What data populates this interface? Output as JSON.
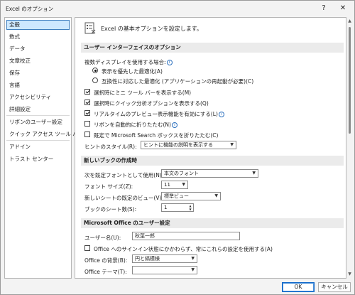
{
  "window": {
    "title": "Excel のオプション",
    "help_label": "?",
    "close_label": "✕"
  },
  "sidebar": {
    "items": [
      {
        "label": "全般"
      },
      {
        "label": "数式"
      },
      {
        "label": "データ"
      },
      {
        "label": "文章校正"
      },
      {
        "label": "保存"
      },
      {
        "label": "言語"
      },
      {
        "label": "アクセシビリティ"
      },
      {
        "label": "詳細設定"
      },
      {
        "label": "リボンのユーザー設定"
      },
      {
        "label": "クイック アクセス ツール バー"
      },
      {
        "label": "アドイン"
      },
      {
        "label": "トラスト センター"
      }
    ]
  },
  "main": {
    "header": "Excel の基本オプションを設定します。",
    "ui_section": {
      "title": "ユーザー インターフェイスのオプション",
      "multi_display_label": "複数ディスプレイを使用する場合:",
      "radio_appearance": "表示を優先した最適化(A)",
      "radio_compat": "互換性に対応した最適化 (アプリケーションの再起動が必要)(C)",
      "cb_minitoolbar": "選択時にミニ ツール バーを表示する(M)",
      "cb_quickanalysis": "選択時にクイック分析オプションを表示する(Q)",
      "cb_livepreview": "リアルタイムのプレビュー表示機能を有効にする(L)",
      "cb_ribbon_collapse": "リボンを自動的に折りたたむ(N)",
      "cb_search_collapse": "既定で Microsoft Search ボックスを折りたたむ(C)",
      "tooltip_label": "ヒントのスタイル(R):",
      "tooltip_value": "ヒントに機能の説明を表示する"
    },
    "new_wb_section": {
      "title": "新しいブックの作成時",
      "default_font_label": "次を既定フォントとして使用(N):",
      "default_font_value": "本文のフォント",
      "font_size_label": "フォント サイズ(Z):",
      "font_size_value": "11",
      "default_view_label": "新しいシートの既定のビュー(V):",
      "default_view_value": "標準ビュー",
      "sheet_count_label": "ブックのシート数(S):",
      "sheet_count_value": "1"
    },
    "office_section": {
      "title": "Microsoft Office のユーザー設定",
      "username_label": "ユーザー名(U):",
      "username_value": "秋葉一郎",
      "always_use_label": "Office へのサインイン状態にかかわらず、常にこれらの設定を使用する(A)",
      "background_label": "Office の背景(B):",
      "background_value": "円と縞模様",
      "theme_label": "Office テーマ(T):",
      "theme_value": ""
    }
  },
  "footer": {
    "ok_label": "OK",
    "cancel_label": "キャンセル"
  },
  "colors": {
    "selected_bg": "#cde8ff",
    "selected_border": "#3f7fbf",
    "info_icon": "#2a6fbd",
    "primary_button_border": "#0a64c8"
  }
}
